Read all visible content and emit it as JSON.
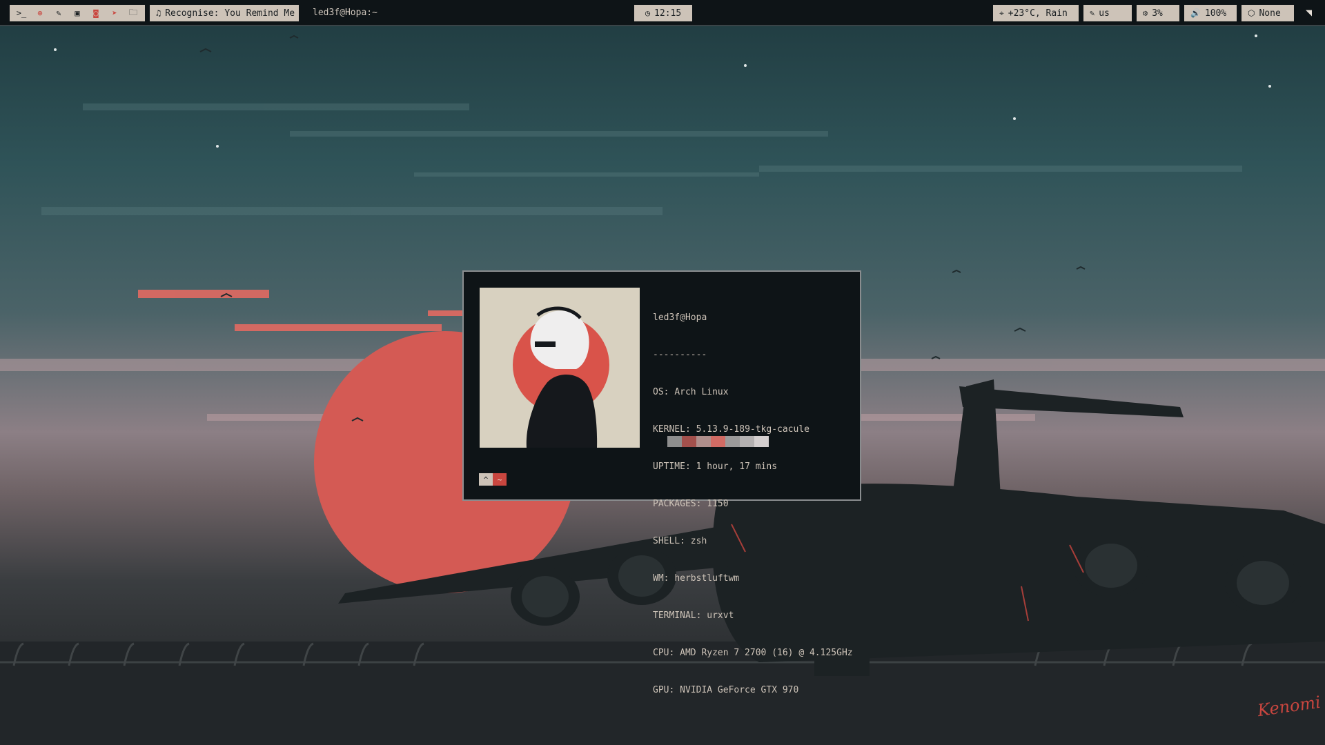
{
  "topbar": {
    "launcher_icons": [
      "terminal-icon",
      "globe-icon",
      "editor-icon",
      "image-icon",
      "camera-icon",
      "send-icon",
      "files-icon"
    ],
    "launcher_glyphs": [
      ">_",
      "⊕",
      "✎",
      "▣",
      "◙",
      "➤",
      "🗀"
    ],
    "music": {
      "icon": "♫",
      "text": "Recognise: You Remind Me"
    },
    "window_title": "led3f@Hopa:~",
    "clock": {
      "icon": "◷",
      "text": "12:15"
    },
    "weather": {
      "icon": "⌖",
      "text": "+23°C, Rain"
    },
    "keyboard": {
      "icon": "✎",
      "text": "us"
    },
    "cpu": {
      "icon": "⚙",
      "text": "3%"
    },
    "volume": {
      "icon": "🔊",
      "text": "100%"
    },
    "packages": {
      "icon": "⬡",
      "text": "None"
    },
    "tray_icon": "telegram-icon",
    "tray_glyph": "◥"
  },
  "terminal": {
    "header": "led3f@Hopa",
    "separator": "----------",
    "lines": [
      {
        "key": "OS",
        "value": "Arch Linux"
      },
      {
        "key": "KERNEL",
        "value": "5.13.9-189-tkg-cacule"
      },
      {
        "key": "UPTIME",
        "value": "1 hour, 17 mins"
      },
      {
        "key": "PACKAGES",
        "value": "1150"
      },
      {
        "key": "SHELL",
        "value": "zsh"
      },
      {
        "key": "WM",
        "value": "herbstluftwm"
      },
      {
        "key": "TERMINAL",
        "value": "urxvt"
      },
      {
        "key": "CPU",
        "value": "AMD Ryzen 7 2700 (16) @ 4.125GHz"
      },
      {
        "key": "GPU",
        "value": "NVIDIA GeForce GTX 970"
      }
    ],
    "palette": [
      "#8e8e8e",
      "#a3504c",
      "#b08f8c",
      "#d16b64",
      "#9b9a9a",
      "#b4b1b1",
      "#d4cfcf"
    ],
    "prompt": [
      "^",
      "~"
    ]
  },
  "wallpaper": {
    "signature": "Kenomi"
  },
  "colors": {
    "bar_bg": "#0e1417",
    "chip_bg": "#cdc3b8",
    "accent": "#c9463f",
    "sky_top": "#2f4f53",
    "sun": "#d45a54"
  }
}
